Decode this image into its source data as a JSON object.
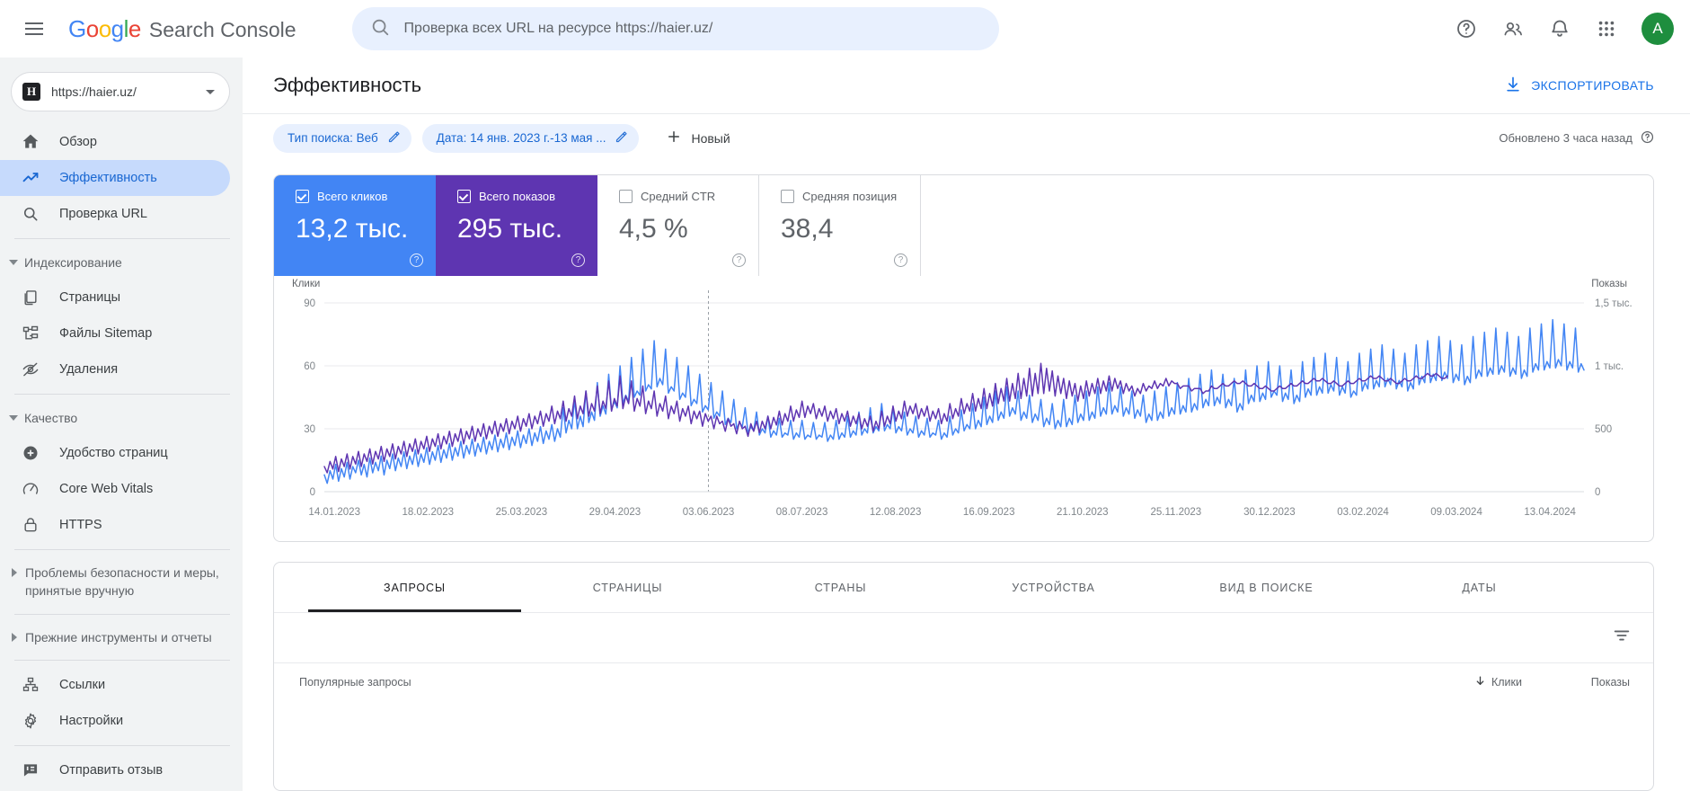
{
  "topbar": {
    "menu_icon": "hamburger-icon",
    "logo_text": "Google",
    "product_name": "Search Console",
    "search_placeholder": "Проверка всех URL на ресурсе https://haier.uz/",
    "search_value": "",
    "search_icon": "search-icon",
    "help_icon": "help-icon",
    "accounts_icon": "accounts-icon",
    "notifications_icon": "bell-icon",
    "apps_icon": "apps-grid-icon",
    "avatar_letter": "A"
  },
  "sidebar": {
    "property": {
      "favicon_letter": "H",
      "url": "https://haier.uz/",
      "caret_icon": "chevron-down-icon"
    },
    "items": [
      {
        "label": "Обзор",
        "icon": "home-icon",
        "active": false
      },
      {
        "label": "Эффективность",
        "icon": "trending-up-icon",
        "active": true
      },
      {
        "label": "Проверка URL",
        "icon": "search-icon",
        "active": false
      }
    ],
    "group_indexing": {
      "label": "Индексирование",
      "icon": "triangle-down-icon"
    },
    "indexing_items": [
      {
        "label": "Страницы",
        "icon": "pages-icon"
      },
      {
        "label": "Файлы Sitemap",
        "icon": "sitemap-icon"
      },
      {
        "label": "Удаления",
        "icon": "eye-off-icon"
      }
    ],
    "group_quality": {
      "label": "Качество",
      "icon": "triangle-down-icon"
    },
    "quality_items": [
      {
        "label": "Удобство страниц",
        "icon": "page-experience-icon"
      },
      {
        "label": "Core Web Vitals",
        "icon": "speedometer-icon"
      },
      {
        "label": "HTTPS",
        "icon": "lock-icon"
      }
    ],
    "security": {
      "label": "Проблемы безопасности и меры, принятые вручную",
      "icon": "triangle-right-icon"
    },
    "legacy": {
      "label": "Прежние инструменты и отчеты",
      "icon": "triangle-right-icon"
    },
    "tools": [
      {
        "label": "Ссылки",
        "icon": "links-icon"
      },
      {
        "label": "Настройки",
        "icon": "gear-icon"
      }
    ],
    "feedback": {
      "label": "Отправить отзыв",
      "icon": "feedback-icon"
    }
  },
  "page": {
    "title": "Эффективность",
    "export_label": "ЭКСПОРТИРОВАТЬ",
    "export_icon": "download-icon"
  },
  "filters": {
    "chips": [
      {
        "label": "Тип поиска: Веб",
        "edit_icon": "pencil-icon"
      },
      {
        "label": "Дата: 14 янв. 2023 г.-13 мая ...",
        "edit_icon": "pencil-icon"
      }
    ],
    "new_label": "Новый",
    "new_icon": "plus-icon",
    "updated_text": "Обновлено 3 часа назад",
    "updated_icon": "help-icon"
  },
  "metrics": [
    {
      "id": "clicks",
      "label": "Всего кликов",
      "value": "13,2 тыс.",
      "checked": true,
      "color": "#4285f4",
      "help_icon": "help-icon"
    },
    {
      "id": "impressions",
      "label": "Всего показов",
      "value": "295 тыс.",
      "checked": true,
      "color": "#5e35b1",
      "help_icon": "help-icon"
    },
    {
      "id": "ctr",
      "label": "Средний CTR",
      "value": "4,5 %",
      "checked": false,
      "color": "#5f6368",
      "help_icon": "help-icon"
    },
    {
      "id": "position",
      "label": "Средняя позиция",
      "value": "38,4",
      "checked": false,
      "color": "#5f6368",
      "help_icon": "help-icon"
    }
  ],
  "chart_data": {
    "type": "line",
    "title": "",
    "left_axis_label": "Клики",
    "right_axis_label": "Показы",
    "left_ticks": [
      "0",
      "30",
      "60",
      "90"
    ],
    "left_values": [
      0,
      30,
      60,
      90
    ],
    "right_ticks": [
      "0",
      "500",
      "1 тыс.",
      "1,5 тыс."
    ],
    "right_values": [
      0,
      500,
      1000,
      1500
    ],
    "ylim_left": [
      0,
      90
    ],
    "ylim_right": [
      0,
      1500
    ],
    "grid": true,
    "legend": "none",
    "x_tick_labels": [
      "14.01.2023",
      "18.02.2023",
      "25.03.2023",
      "29.04.2023",
      "03.06.2023",
      "08.07.2023",
      "12.08.2023",
      "16.09.2023",
      "21.10.2023",
      "25.11.2023",
      "30.12.2023",
      "03.02.2024",
      "09.03.2024",
      "13.04.2024"
    ],
    "marker_date": "03.06.2023",
    "series": [
      {
        "name": "Клики",
        "color": "#4285f4",
        "axis": "left",
        "values": [
          8,
          4,
          10,
          6,
          13,
          5,
          11,
          7,
          14,
          6,
          12,
          9,
          15,
          8,
          13,
          7,
          16,
          9,
          14,
          10,
          17,
          8,
          15,
          11,
          18,
          10,
          16,
          12,
          19,
          11,
          17,
          13,
          20,
          12,
          18,
          14,
          21,
          13,
          19,
          15,
          22,
          14,
          20,
          16,
          23,
          15,
          21,
          17,
          24,
          16,
          22,
          18,
          25,
          17,
          23,
          19,
          26,
          18,
          24,
          20,
          27,
          19,
          25,
          21,
          28,
          20,
          26,
          22,
          29,
          21,
          27,
          23,
          30,
          22,
          28,
          24,
          31,
          23,
          29,
          25,
          32,
          24,
          30,
          26,
          40,
          28,
          34,
          30,
          44,
          30,
          36,
          31,
          48,
          33,
          38,
          34,
          52,
          36,
          41,
          37,
          56,
          39,
          43,
          40,
          60,
          42,
          46,
          43,
          64,
          45,
          48,
          46,
          68,
          48,
          51,
          49,
          72,
          50,
          54,
          51,
          68,
          47,
          50,
          48,
          64,
          44,
          47,
          45,
          60,
          41,
          44,
          42,
          56,
          38,
          41,
          39,
          52,
          35,
          38,
          36,
          48,
          32,
          35,
          33,
          44,
          30,
          33,
          31,
          40,
          28,
          31,
          29,
          38,
          27,
          30,
          28,
          36,
          26,
          29,
          27,
          35,
          26,
          28,
          27,
          34,
          25,
          28,
          26,
          34,
          25,
          27,
          26,
          33,
          25,
          27,
          26,
          33,
          24,
          27,
          25,
          34,
          25,
          28,
          26,
          36,
          26,
          29,
          27,
          38,
          27,
          30,
          28,
          40,
          28,
          31,
          29,
          42,
          29,
          32,
          30,
          40,
          28,
          31,
          29,
          38,
          27,
          30,
          28,
          36,
          26,
          29,
          27,
          35,
          26,
          28,
          27,
          34,
          25,
          28,
          26,
          36,
          27,
          30,
          28,
          39,
          29,
          32,
          30,
          42,
          30,
          34,
          31,
          45,
          32,
          36,
          33,
          48,
          34,
          38,
          35,
          50,
          36,
          40,
          37,
          48,
          34,
          38,
          35,
          46,
          33,
          37,
          34,
          44,
          31,
          35,
          32,
          42,
          30,
          34,
          31,
          44,
          31,
          35,
          32,
          46,
          33,
          37,
          34,
          48,
          34,
          38,
          35,
          50,
          36,
          40,
          37,
          52,
          37,
          41,
          38,
          50,
          36,
          40,
          37,
          48,
          35,
          39,
          36,
          46,
          33,
          37,
          34,
          48,
          34,
          38,
          35,
          50,
          36,
          40,
          37,
          52,
          37,
          41,
          38,
          54,
          38,
          42,
          39,
          56,
          40,
          44,
          41,
          58,
          41,
          45,
          42,
          56,
          40,
          44,
          41,
          54,
          38,
          42,
          39,
          58,
          42,
          46,
          43,
          60,
          43,
          47,
          44,
          62,
          45,
          48,
          46,
          60,
          43,
          47,
          44,
          58,
          42,
          46,
          43,
          62,
          45,
          49,
          46,
          64,
          46,
          50,
          47,
          66,
          47,
          51,
          48,
          64,
          46,
          50,
          47,
          62,
          45,
          48,
          46,
          66,
          48,
          52,
          49,
          68,
          49,
          53,
          50,
          70,
          50,
          54,
          51,
          68,
          49,
          53,
          50,
          66,
          48,
          52,
          49,
          70,
          51,
          55,
          52,
          72,
          52,
          56,
          53,
          74,
          53,
          57,
          54,
          72,
          52,
          56,
          53,
          70,
          51,
          55,
          52,
          74,
          54,
          58,
          55,
          76,
          55,
          59,
          56,
          78,
          56,
          60,
          57,
          76,
          55,
          59,
          56,
          74,
          54,
          58,
          55,
          78,
          57,
          61,
          58,
          80,
          58,
          62,
          59,
          82,
          59,
          63,
          60,
          80,
          58,
          62,
          59,
          78,
          57,
          61,
          58
        ]
      },
      {
        "name": "Показы",
        "color": "#5e35b1",
        "axis": "right",
        "values": [
          200,
          150,
          240,
          180,
          280,
          160,
          260,
          200,
          300,
          180,
          280,
          220,
          320,
          200,
          300,
          240,
          340,
          220,
          320,
          260,
          360,
          240,
          340,
          280,
          380,
          260,
          360,
          300,
          400,
          280,
          380,
          320,
          420,
          300,
          400,
          340,
          440,
          320,
          420,
          360,
          460,
          340,
          440,
          380,
          480,
          360,
          460,
          400,
          500,
          380,
          480,
          420,
          520,
          400,
          500,
          440,
          540,
          420,
          520,
          460,
          560,
          440,
          540,
          480,
          580,
          460,
          560,
          500,
          600,
          480,
          580,
          520,
          620,
          500,
          600,
          540,
          640,
          520,
          620,
          560,
          680,
          540,
          640,
          580,
          720,
          560,
          660,
          600,
          760,
          580,
          680,
          620,
          800,
          600,
          700,
          640,
          840,
          620,
          720,
          660,
          880,
          640,
          740,
          680,
          920,
          660,
          760,
          700,
          880,
          640,
          740,
          680,
          840,
          620,
          720,
          660,
          800,
          600,
          700,
          640,
          760,
          580,
          680,
          620,
          720,
          560,
          660,
          600,
          680,
          540,
          640,
          580,
          640,
          520,
          620,
          560,
          600,
          500,
          600,
          540,
          560,
          480,
          580,
          520,
          540,
          460,
          560,
          500,
          520,
          440,
          540,
          480,
          560,
          470,
          560,
          500,
          600,
          500,
          590,
          530,
          640,
          530,
          620,
          560,
          680,
          560,
          650,
          590,
          720,
          590,
          680,
          620,
          700,
          580,
          660,
          600,
          680,
          560,
          640,
          580,
          660,
          540,
          620,
          560,
          640,
          520,
          600,
          540,
          620,
          500,
          580,
          520,
          600,
          480,
          560,
          500,
          640,
          520,
          600,
          540,
          680,
          560,
          640,
          580,
          720,
          600,
          680,
          620,
          700,
          580,
          660,
          600,
          680,
          560,
          640,
          580,
          660,
          540,
          620,
          560,
          700,
          580,
          660,
          600,
          740,
          620,
          700,
          640,
          780,
          640,
          740,
          660,
          820,
          660,
          780,
          680,
          860,
          700,
          820,
          720,
          900,
          720,
          860,
          740,
          940,
          740,
          900,
          760,
          980,
          760,
          940,
          780,
          1020,
          780,
          980,
          800,
          960,
          760,
          920,
          780,
          900,
          740,
          880,
          760,
          860,
          720,
          840,
          740,
          880,
          760,
          860,
          780,
          900,
          780,
          880,
          800,
          920,
          800,
          900,
          820,
          880,
          780,
          860,
          800,
          840,
          760,
          820,
          780,
          860,
          800,
          840,
          820,
          880,
          820,
          860,
          840,
          900,
          840,
          880,
          860,
          860,
          820,
          840,
          840,
          840,
          800,
          820,
          820,
          820,
          780,
          800,
          800,
          840,
          820,
          820,
          840,
          860,
          840,
          840,
          860,
          880,
          860,
          860,
          880,
          860,
          840,
          840,
          860,
          840,
          820,
          820,
          840,
          820,
          800,
          800,
          820,
          840,
          820,
          820,
          840,
          860,
          840,
          840,
          860,
          880,
          860,
          860,
          880,
          900,
          880,
          880,
          900,
          880,
          860,
          860,
          880,
          860,
          840,
          840,
          860,
          880,
          860,
          860,
          880,
          900,
          880,
          880,
          900,
          920,
          900,
          900,
          920,
          900,
          880,
          880,
          900,
          880,
          860,
          860,
          880,
          900,
          880,
          880,
          900,
          920,
          900,
          900,
          920,
          940,
          920,
          920,
          940,
          920,
          900,
          900,
          920
        ]
      }
    ]
  },
  "tabs": [
    {
      "label": "ЗАПРОСЫ",
      "active": true
    },
    {
      "label": "СТРАНИЦЫ",
      "active": false
    },
    {
      "label": "СТРАНЫ",
      "active": false
    },
    {
      "label": "УСТРОЙСТВА",
      "active": false
    },
    {
      "label": "ВИД В ПОИСКЕ",
      "active": false
    },
    {
      "label": "ДАТЫ",
      "active": false
    }
  ],
  "table": {
    "filter_icon": "filter-list-icon",
    "col_query": "Популярные запросы",
    "col_clicks": "Клики",
    "col_impressions": "Показы",
    "sort_icon": "arrow-down-icon"
  }
}
